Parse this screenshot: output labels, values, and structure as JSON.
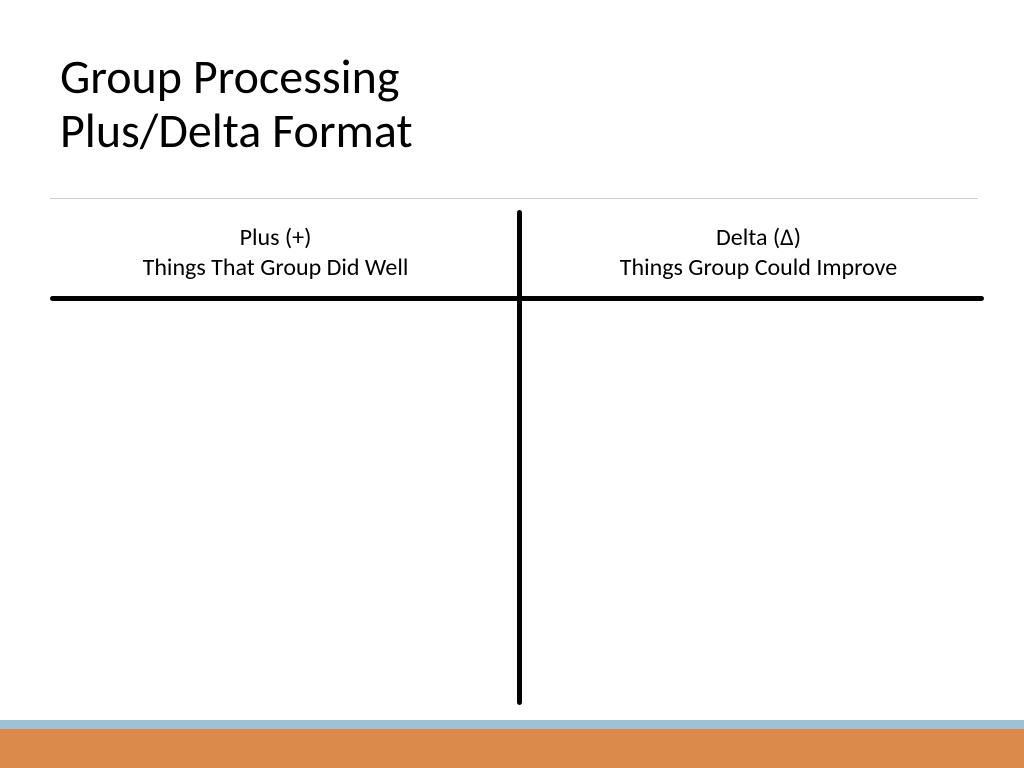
{
  "slide": {
    "title_line1": "Group Processing",
    "title_line2": "Plus/Delta Format",
    "plus": {
      "heading": "Plus (+)",
      "sub": "Things That Group Did Well"
    },
    "delta": {
      "heading": "Delta (∆)",
      "sub": "Things Group Could Improve"
    }
  },
  "colors": {
    "orange": "#dc8a4c",
    "blue": "#9fc1d6"
  }
}
